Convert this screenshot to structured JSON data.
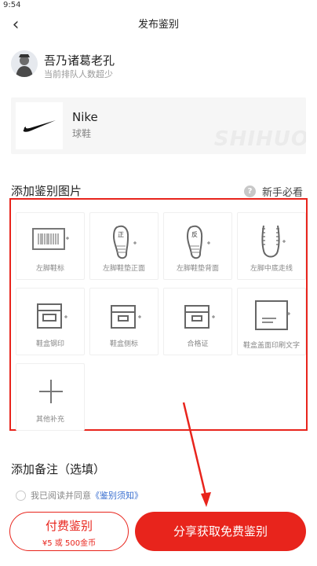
{
  "status_bar": {
    "time": "9:54"
  },
  "nav": {
    "back_icon": "‹",
    "title": "发布鉴别"
  },
  "user": {
    "name": "吾乃诸葛老孔",
    "subtitle": "当前排队人数超少"
  },
  "product": {
    "brand": "Nike",
    "category": "球鞋",
    "watermark": "SHIHUO"
  },
  "photos": {
    "title": "添加鉴别图片",
    "help_icon": "?",
    "help_label": "新手必看",
    "tiles": [
      {
        "label": "左脚鞋标",
        "icon": "barcode-icon"
      },
      {
        "label": "左脚鞋垫正面",
        "icon": "insole-front-icon",
        "mark": "正"
      },
      {
        "label": "左脚鞋垫背面",
        "icon": "insole-back-icon",
        "mark": "反"
      },
      {
        "label": "左脚中底走线",
        "icon": "midsole-stitch-icon"
      },
      {
        "label": "鞋盒钢印",
        "icon": "box-stamp-icon"
      },
      {
        "label": "鞋盒侧标",
        "icon": "box-side-label-icon"
      },
      {
        "label": "合格证",
        "icon": "certificate-icon"
      },
      {
        "label": "鞋盒盖面印刷文字",
        "icon": "box-lid-text-icon"
      },
      {
        "label": "其他补充",
        "icon": "plus-icon"
      }
    ]
  },
  "note": {
    "title": "添加备注（选填）"
  },
  "agree": {
    "text": "我已阅读并同意",
    "link": "《鉴别须知》"
  },
  "buttons": {
    "pay_label": "付费鉴别",
    "pay_price": "¥5 或 500金币",
    "share_label": "分享获取免费鉴别"
  },
  "colors": {
    "accent": "#e8241c",
    "link": "#3a6fd0"
  }
}
